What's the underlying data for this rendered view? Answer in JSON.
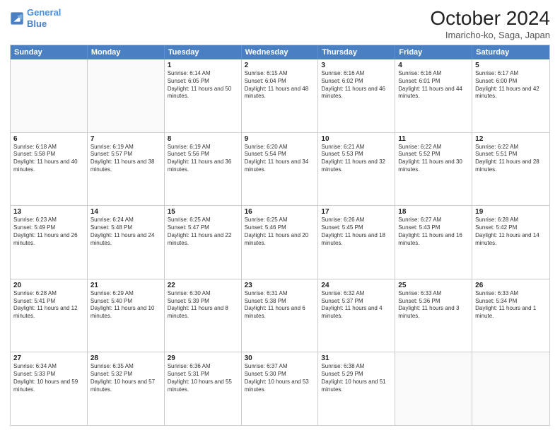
{
  "header": {
    "logo_line1": "General",
    "logo_line2": "Blue",
    "month": "October 2024",
    "location": "Imaricho-ko, Saga, Japan"
  },
  "days": [
    "Sunday",
    "Monday",
    "Tuesday",
    "Wednesday",
    "Thursday",
    "Friday",
    "Saturday"
  ],
  "weeks": [
    [
      {
        "day": null
      },
      {
        "day": null
      },
      {
        "day": "1",
        "sunrise": "6:14 AM",
        "sunset": "6:05 PM",
        "daylight": "11 hours and 50 minutes."
      },
      {
        "day": "2",
        "sunrise": "6:15 AM",
        "sunset": "6:04 PM",
        "daylight": "11 hours and 48 minutes."
      },
      {
        "day": "3",
        "sunrise": "6:16 AM",
        "sunset": "6:02 PM",
        "daylight": "11 hours and 46 minutes."
      },
      {
        "day": "4",
        "sunrise": "6:16 AM",
        "sunset": "6:01 PM",
        "daylight": "11 hours and 44 minutes."
      },
      {
        "day": "5",
        "sunrise": "6:17 AM",
        "sunset": "6:00 PM",
        "daylight": "11 hours and 42 minutes."
      }
    ],
    [
      {
        "day": "6",
        "sunrise": "6:18 AM",
        "sunset": "5:58 PM",
        "daylight": "11 hours and 40 minutes."
      },
      {
        "day": "7",
        "sunrise": "6:19 AM",
        "sunset": "5:57 PM",
        "daylight": "11 hours and 38 minutes."
      },
      {
        "day": "8",
        "sunrise": "6:19 AM",
        "sunset": "5:56 PM",
        "daylight": "11 hours and 36 minutes."
      },
      {
        "day": "9",
        "sunrise": "6:20 AM",
        "sunset": "5:54 PM",
        "daylight": "11 hours and 34 minutes."
      },
      {
        "day": "10",
        "sunrise": "6:21 AM",
        "sunset": "5:53 PM",
        "daylight": "11 hours and 32 minutes."
      },
      {
        "day": "11",
        "sunrise": "6:22 AM",
        "sunset": "5:52 PM",
        "daylight": "11 hours and 30 minutes."
      },
      {
        "day": "12",
        "sunrise": "6:22 AM",
        "sunset": "5:51 PM",
        "daylight": "11 hours and 28 minutes."
      }
    ],
    [
      {
        "day": "13",
        "sunrise": "6:23 AM",
        "sunset": "5:49 PM",
        "daylight": "11 hours and 26 minutes."
      },
      {
        "day": "14",
        "sunrise": "6:24 AM",
        "sunset": "5:48 PM",
        "daylight": "11 hours and 24 minutes."
      },
      {
        "day": "15",
        "sunrise": "6:25 AM",
        "sunset": "5:47 PM",
        "daylight": "11 hours and 22 minutes."
      },
      {
        "day": "16",
        "sunrise": "6:25 AM",
        "sunset": "5:46 PM",
        "daylight": "11 hours and 20 minutes."
      },
      {
        "day": "17",
        "sunrise": "6:26 AM",
        "sunset": "5:45 PM",
        "daylight": "11 hours and 18 minutes."
      },
      {
        "day": "18",
        "sunrise": "6:27 AM",
        "sunset": "5:43 PM",
        "daylight": "11 hours and 16 minutes."
      },
      {
        "day": "19",
        "sunrise": "6:28 AM",
        "sunset": "5:42 PM",
        "daylight": "11 hours and 14 minutes."
      }
    ],
    [
      {
        "day": "20",
        "sunrise": "6:28 AM",
        "sunset": "5:41 PM",
        "daylight": "11 hours and 12 minutes."
      },
      {
        "day": "21",
        "sunrise": "6:29 AM",
        "sunset": "5:40 PM",
        "daylight": "11 hours and 10 minutes."
      },
      {
        "day": "22",
        "sunrise": "6:30 AM",
        "sunset": "5:39 PM",
        "daylight": "11 hours and 8 minutes."
      },
      {
        "day": "23",
        "sunrise": "6:31 AM",
        "sunset": "5:38 PM",
        "daylight": "11 hours and 6 minutes."
      },
      {
        "day": "24",
        "sunrise": "6:32 AM",
        "sunset": "5:37 PM",
        "daylight": "11 hours and 4 minutes."
      },
      {
        "day": "25",
        "sunrise": "6:33 AM",
        "sunset": "5:36 PM",
        "daylight": "11 hours and 3 minutes."
      },
      {
        "day": "26",
        "sunrise": "6:33 AM",
        "sunset": "5:34 PM",
        "daylight": "11 hours and 1 minute."
      }
    ],
    [
      {
        "day": "27",
        "sunrise": "6:34 AM",
        "sunset": "5:33 PM",
        "daylight": "10 hours and 59 minutes."
      },
      {
        "day": "28",
        "sunrise": "6:35 AM",
        "sunset": "5:32 PM",
        "daylight": "10 hours and 57 minutes."
      },
      {
        "day": "29",
        "sunrise": "6:36 AM",
        "sunset": "5:31 PM",
        "daylight": "10 hours and 55 minutes."
      },
      {
        "day": "30",
        "sunrise": "6:37 AM",
        "sunset": "5:30 PM",
        "daylight": "10 hours and 53 minutes."
      },
      {
        "day": "31",
        "sunrise": "6:38 AM",
        "sunset": "5:29 PM",
        "daylight": "10 hours and 51 minutes."
      },
      {
        "day": null
      },
      {
        "day": null
      }
    ]
  ]
}
